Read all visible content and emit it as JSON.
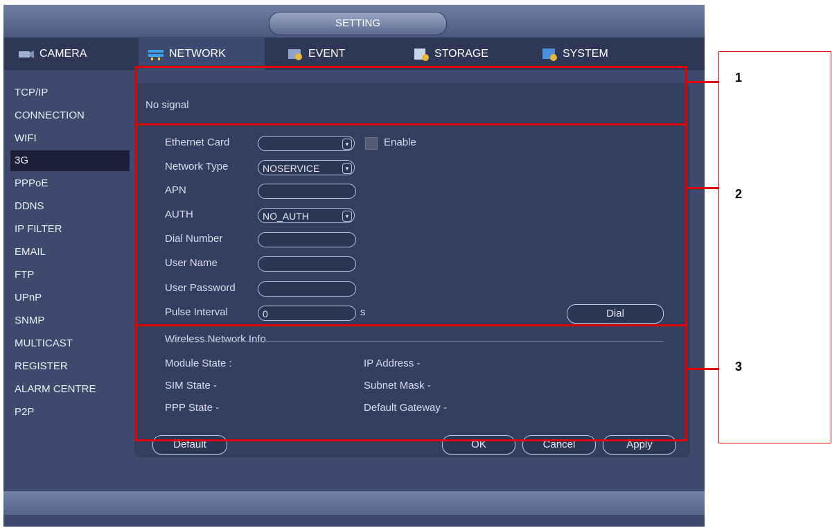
{
  "window": {
    "title": "SETTING"
  },
  "tabs": [
    {
      "label": "CAMERA",
      "icon": "camera-icon"
    },
    {
      "label": "NETWORK",
      "icon": "network-icon"
    },
    {
      "label": "EVENT",
      "icon": "event-icon"
    },
    {
      "label": "STORAGE",
      "icon": "storage-icon"
    },
    {
      "label": "SYSTEM",
      "icon": "system-icon"
    }
  ],
  "active_tab": "NETWORK",
  "sidebar": {
    "items": [
      "TCP/IP",
      "CONNECTION",
      "WIFI",
      "3G",
      "PPPoE",
      "DDNS",
      "IP FILTER",
      "EMAIL",
      "FTP",
      "UPnP",
      "SNMP",
      "MULTICAST",
      "REGISTER",
      "ALARM CENTRE",
      "P2P"
    ],
    "active": "3G"
  },
  "signal": {
    "text": "No signal"
  },
  "form": {
    "ethernet_card": {
      "label": "Ethernet Card",
      "value": ""
    },
    "enable": {
      "label": "Enable",
      "checked": false
    },
    "network_type": {
      "label": "Network Type",
      "value": "NOSERVICE"
    },
    "apn": {
      "label": "APN",
      "value": ""
    },
    "auth": {
      "label": "AUTH",
      "value": "NO_AUTH"
    },
    "dial_number": {
      "label": "Dial Number",
      "value": ""
    },
    "user_name": {
      "label": "User Name",
      "value": ""
    },
    "user_password": {
      "label": "User Password",
      "value": ""
    },
    "pulse_interval": {
      "label": "Pulse Interval",
      "value": "0",
      "unit": "s"
    },
    "dial_button": "Dial"
  },
  "wireless_info": {
    "heading": "Wireless Network Info",
    "module_state": "Module State :",
    "sim_state": "SIM State -",
    "ppp_state": "PPP State -",
    "ip_address": "IP Address -",
    "subnet_mask": "Subnet Mask -",
    "default_gateway": "Default Gateway -"
  },
  "buttons": {
    "default": "Default",
    "ok": "OK",
    "cancel": "Cancel",
    "apply": "Apply"
  },
  "callouts": [
    "1",
    "2",
    "3"
  ],
  "colors": {
    "annotation_red": "#e00000",
    "panel_bg": "#3d4a6d"
  }
}
